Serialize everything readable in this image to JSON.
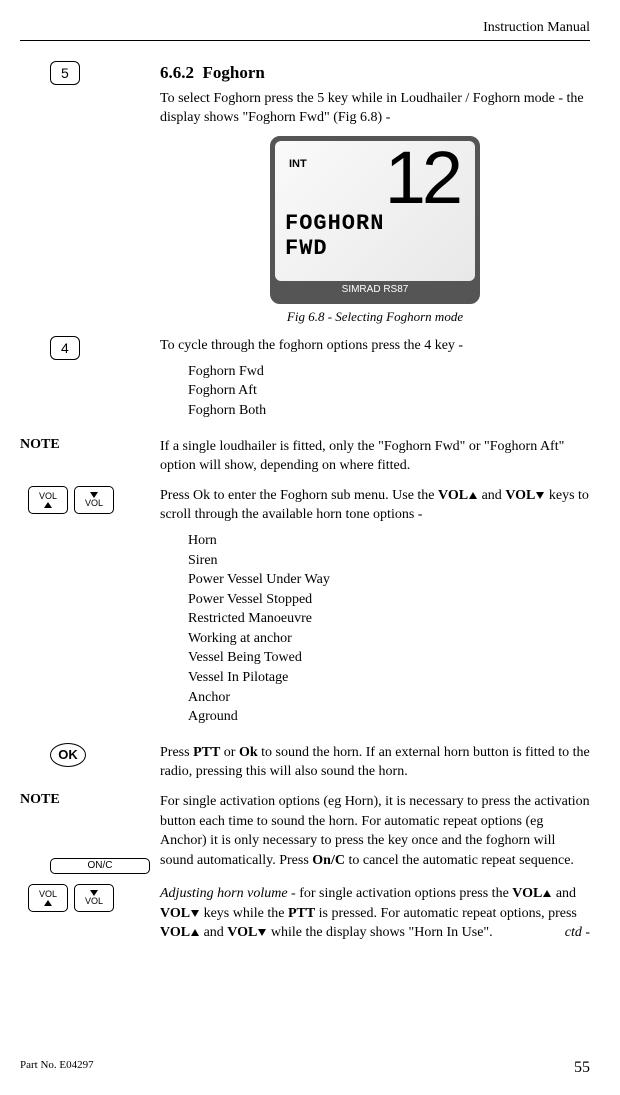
{
  "header": {
    "title": "Instruction Manual"
  },
  "section": {
    "number": "6.6.2",
    "title": "Foghorn",
    "intro": "To select Foghorn press the 5 key while in Loudhailer / Foghorn mode - the display shows \"Foghorn Fwd\" (Fig 6.8) -"
  },
  "keys": {
    "five": "5",
    "four": "4",
    "ok": "OK",
    "vol": "VOL",
    "onc": "ON/C"
  },
  "lcd": {
    "int": "INT",
    "channel": "12",
    "line1": "FOGHORN",
    "line2": "FWD",
    "brand": "SIMRAD RS87"
  },
  "fig_caption": "Fig 6.8 - Selecting Foghorn mode",
  "cycle_text": "To cycle through the foghorn options press the 4 key -",
  "foghorn_options": [
    "Foghorn Fwd",
    "Foghorn Aft",
    "Foghorn Both"
  ],
  "note1_label": "NOTE",
  "note1_text": "If a single loudhailer is fitted, only the \"Foghorn Fwd\" or \"Foghorn Aft\" option will show, depending on where fitted.",
  "submenu_text1": "Press Ok to enter the Foghorn sub menu.  Use the ",
  "vol_bold": "VOL",
  "submenu_text2": " and ",
  "submenu_text3": " keys to scroll through the available horn tone options -",
  "tone_options": [
    "Horn",
    "Siren",
    "Power Vessel Under Way",
    "Power Vessel Stopped",
    "Restricted Manoeuvre",
    "Working at anchor",
    "Vessel Being Towed",
    "Vessel In Pilotage",
    "Anchor",
    "Aground"
  ],
  "ptt_text1": "Press ",
  "ptt_bold": "PTT",
  "ptt_text2": " or ",
  "ok_bold": "Ok",
  "ptt_text3": " to sound the horn.  If an external horn button is fitted to the radio, pressing this will also sound the horn.",
  "note2_label": "NOTE",
  "note2_text1": "For single activation options (eg Horn), it is necessary to press the activation button each time to sound the horn.  For automatic repeat options (eg Anchor) it is only necessary to press the key once and the foghorn will sound automatically.  Press ",
  "onc_bold": "On/C",
  "note2_text2": " to cancel the automatic repeat sequence.",
  "adjust_lead": "Adjusting horn volume",
  "adjust_text1": " - for single activation options press the ",
  "adjust_text2": " and ",
  "adjust_text3": " keys while the ",
  "adjust_text4": " is pressed.  For automatic repeat options, press ",
  "adjust_text5": " and ",
  "adjust_text6": " while the display shows \"Horn In Use\".",
  "ctd": "ctd -",
  "footer": {
    "part": "Part No. E04297",
    "page": "55"
  }
}
